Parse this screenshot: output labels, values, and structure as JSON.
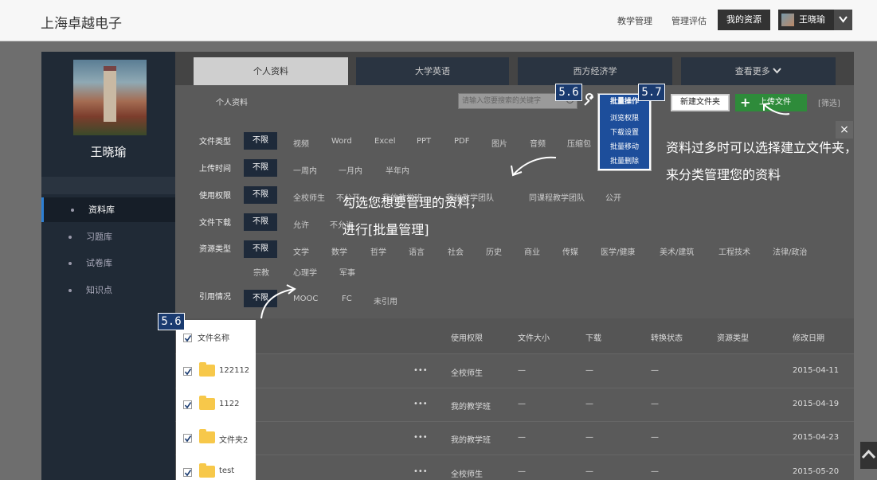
{
  "header": {
    "brand": "上海卓越电子",
    "nav": [
      "教学管理",
      "管理评估",
      "我的资源"
    ],
    "user": "王晓瑜"
  },
  "sidebar": {
    "name": "王晓瑜",
    "items": [
      {
        "label": "资料库",
        "active": true
      },
      {
        "label": "习题库"
      },
      {
        "label": "试卷库"
      },
      {
        "label": "知识点"
      }
    ]
  },
  "tabs": [
    "个人资料",
    "大学英语",
    "西方经济学",
    "查看更多"
  ],
  "toolbar": {
    "crumb": "个人资料",
    "search_placeholder": "请输入您要搜索的关键字",
    "batch_label": "批量操作",
    "batch_menu": [
      "浏览权限",
      "下载设置",
      "批量移动",
      "批量删除"
    ],
    "new_folder": "新建文件夹",
    "upload": "上传文件",
    "filter": "[筛选]"
  },
  "filters": [
    {
      "label": "文件类型",
      "all": "不限",
      "options": [
        "视频",
        "Word",
        "Excel",
        "PPT",
        "PDF",
        "图片",
        "音频",
        "压缩包"
      ]
    },
    {
      "label": "上传时间",
      "all": "不限",
      "options": [
        "一周内",
        "一月内",
        "半年内"
      ]
    },
    {
      "label": "使用权限",
      "all": "不限",
      "options": [
        "全校师生",
        "不公开",
        "我的教学班",
        "我的教学团队",
        "同课程教学团队",
        "公开"
      ]
    },
    {
      "label": "文件下载",
      "all": "不限",
      "options": [
        "允许",
        "不允许"
      ]
    },
    {
      "label": "资源类型",
      "all": "不限",
      "options": [
        "文学",
        "数学",
        "哲学",
        "语言",
        "社会",
        "历史",
        "商业",
        "传媒",
        "医学/健康",
        "美术/建筑",
        "工程技术",
        "法律/政治",
        "宗教",
        "心理学",
        "军事"
      ]
    },
    {
      "label": "引用情况",
      "all": "不限",
      "options": [
        "MOOC",
        "FC",
        "未引用"
      ]
    }
  ],
  "table": {
    "headers": [
      "文件名称",
      "使用权限",
      "文件大小",
      "下载",
      "转换状态",
      "资源类型",
      "修改日期"
    ],
    "rows": [
      {
        "name": "122112",
        "more": "•••",
        "perm": "全校师生",
        "size": "—",
        "dl": "—",
        "conv": "—",
        "date": "2015-04-11"
      },
      {
        "name": "1122",
        "more": "•••",
        "perm": "我的教学班",
        "size": "—",
        "dl": "—",
        "conv": "—",
        "date": "2015-04-19"
      },
      {
        "name": "文件夹2",
        "more": "•••",
        "perm": "我的教学班",
        "size": "—",
        "dl": "—",
        "conv": "—",
        "date": "2015-04-23"
      },
      {
        "name": "test",
        "more": "•••",
        "perm": "全校师生",
        "size": "—",
        "dl": "—",
        "conv": "—",
        "date": "2015-05-20"
      }
    ]
  },
  "annotations": {
    "badge1": "5.6",
    "badge2": "5.6",
    "badge3": "5.7",
    "text1_l1": "勾选您想要管理的资料，",
    "text1_l2": "进行[批量管理]",
    "text2_l1": "资料过多时可以选择建立文件夹，",
    "text2_l2": "来分类管理您的资料"
  },
  "close": "×"
}
